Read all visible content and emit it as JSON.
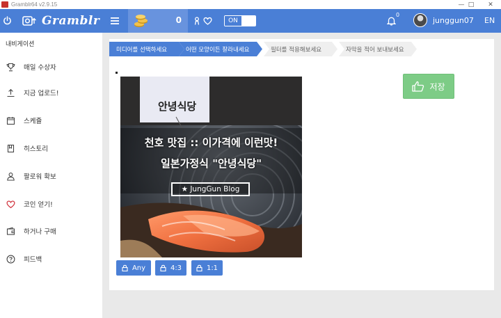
{
  "window": {
    "title": "Gramblr64 v2.9.15"
  },
  "appbar": {
    "logo": "Gramblr",
    "coin_count": "0",
    "toggle_label": "ON",
    "notification_count": "0",
    "username": "junggun07",
    "language": "EN"
  },
  "sidebar": {
    "heading": "내비게이션",
    "items": [
      {
        "label": "매일 수상자",
        "icon": "trophy-icon"
      },
      {
        "label": "지금 업로드!",
        "icon": "upload-icon"
      },
      {
        "label": "스케쥴",
        "icon": "calendar-icon"
      },
      {
        "label": "히스토리",
        "icon": "history-icon"
      },
      {
        "label": "팔로워 확보",
        "icon": "user-icon"
      },
      {
        "label": "코인 얻기!",
        "icon": "heart-icon"
      },
      {
        "label": "하거나 구매",
        "icon": "wallet-icon"
      },
      {
        "label": "피드백",
        "icon": "question-icon"
      }
    ]
  },
  "steps": [
    {
      "label": "미디어를 선택하세요",
      "active": true
    },
    {
      "label": "어떤 모양이든 잘라내세요",
      "active": true
    },
    {
      "label": "필터를 적용해보세요",
      "active": false
    },
    {
      "label": "자막을 적어 보내보세요",
      "active": false
    }
  ],
  "photo": {
    "sign_text": "안녕식당",
    "headline_1": "천호 맛집 :: 이가격에 이런맛!",
    "headline_2": "일본가정식 \"안녕식당\"",
    "badge": "★ JungGun Blog"
  },
  "save_button": {
    "label": "저장"
  },
  "crop_ratios": [
    "Any",
    "4:3",
    "1:1"
  ],
  "colors": {
    "primary": "#4a7fd6",
    "save": "#7dcc86",
    "coin_panel": "#6893de"
  }
}
